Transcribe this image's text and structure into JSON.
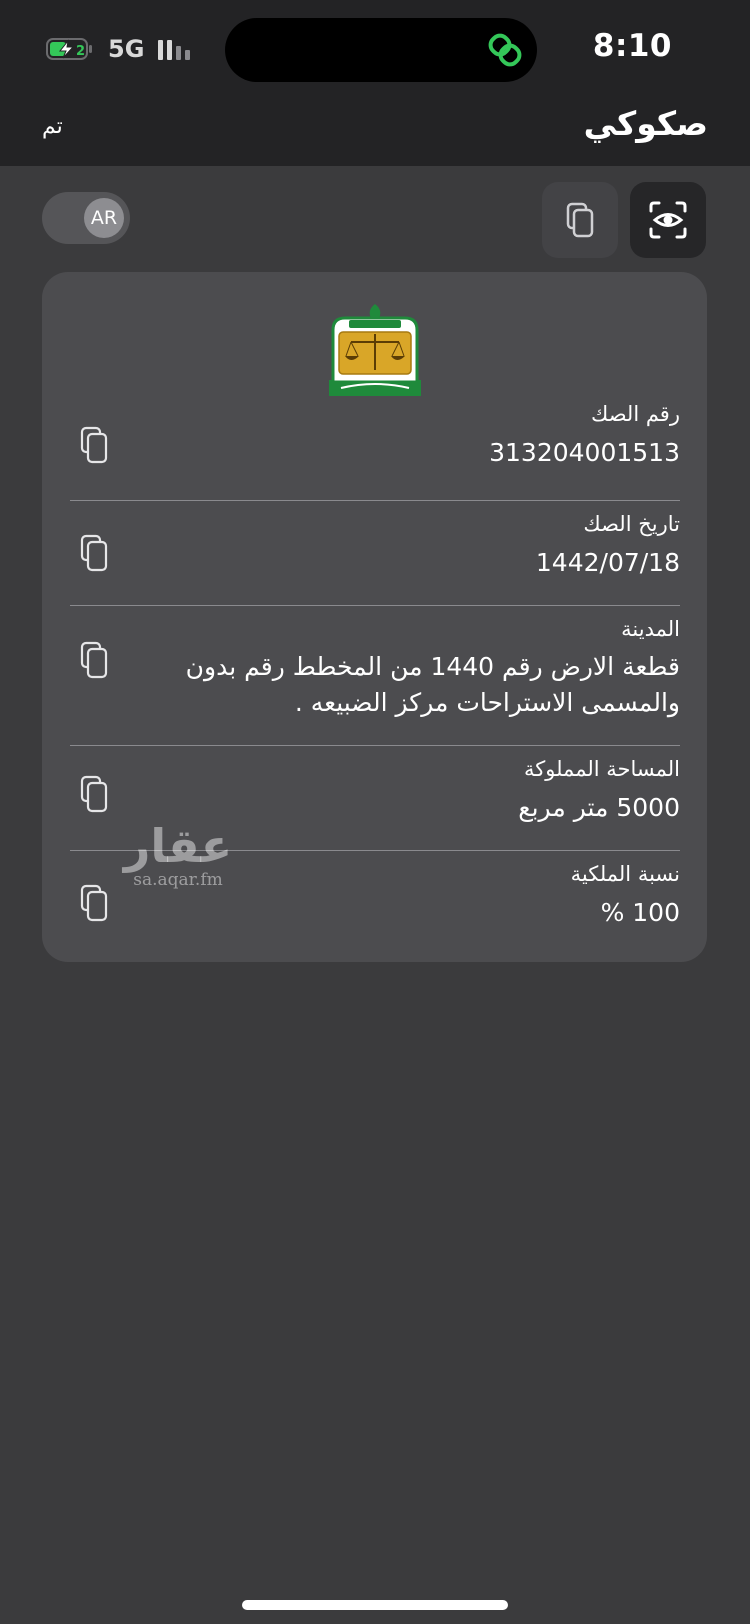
{
  "status_bar": {
    "time": "8:10",
    "network": "5G",
    "battery_icon": "battery-charging-icon",
    "signal_icon": "signal-bars-icon",
    "island_icon": "link-icon",
    "island_icon_color": "#34c759"
  },
  "nav": {
    "title": "صكوكي",
    "done_label": "تم"
  },
  "toolbar": {
    "language_toggle": "AR",
    "copy_icon": "copy-icon",
    "scan_icon": "eye-scan-icon"
  },
  "card": {
    "emblem": "ministry-of-justice-emblem",
    "fields": [
      {
        "label": "رقم الصك",
        "value": "313204001513"
      },
      {
        "label": "تاريخ الصك",
        "value": "1442/07/18"
      },
      {
        "label": "المدينة",
        "value": "قطعة الارض  رقم 1440 من المخطط رقم  بدون  والمسمى الاستراحات  مركز الضبيعه ."
      },
      {
        "label": "المساحة المملوكة",
        "value": "5000 متر مربع"
      },
      {
        "label": "نسبة الملكية",
        "value": "100 %"
      }
    ]
  },
  "watermark": {
    "logo_text": "عقار",
    "url": "sa.aqar.fm"
  },
  "colors": {
    "background": "#3b3b3d",
    "card": "#4c4c4f",
    "header": "#232325",
    "emblem_green": "#1f8a3b",
    "emblem_gold": "#d9a628"
  }
}
